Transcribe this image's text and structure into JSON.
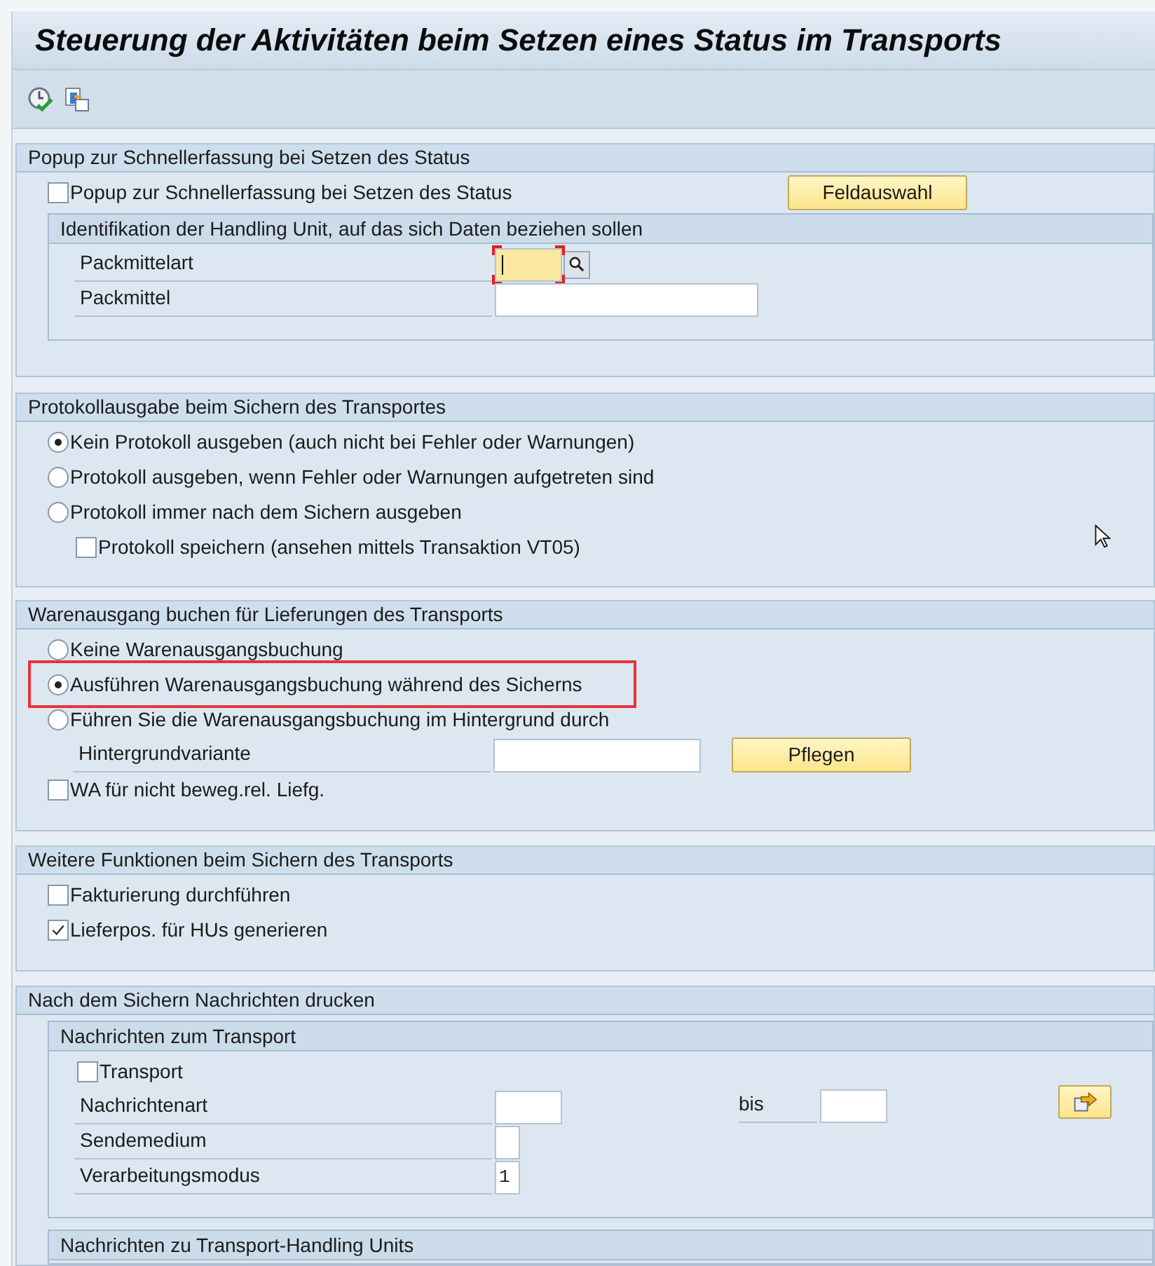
{
  "window": {
    "title": "Steuerung der Aktivitäten beim Setzen eines Status im Transports"
  },
  "toolbar": [
    {
      "kind": "execute"
    },
    {
      "kind": "copy"
    }
  ],
  "sections": [
    {
      "title": "Popup zur Schnellerfassung bei Setzen des Status",
      "items": [
        {
          "kind": "checkbox",
          "label": "Popup zur Schnellerfassung bei Setzen des Status",
          "checked": false,
          "button": "Feldauswahl"
        },
        {
          "kind": "group",
          "title": "Identifikation der Handling Unit, auf das sich Daten beziehen sollen",
          "items": [
            {
              "kind": "field",
              "label": "Packmittelart",
              "focused": true,
              "search_help": true
            },
            {
              "kind": "field",
              "label": "Packmittel",
              "focused": false
            }
          ]
        }
      ]
    },
    {
      "title": "Protokollausgabe beim Sichern des Transportes",
      "items": [
        {
          "kind": "radio",
          "label": "Kein Protokoll ausgeben (auch nicht bei Fehler oder Warnungen)",
          "selected": true
        },
        {
          "kind": "radio",
          "label": "Protokoll ausgeben, wenn Fehler oder Warnungen aufgetreten sind",
          "selected": false
        },
        {
          "kind": "radio",
          "label": "Protokoll immer nach dem Sichern ausgeben",
          "selected": false,
          "children": [
            {
              "kind": "checkbox",
              "label": "Protokoll speichern (ansehen mittels Transaktion VT05)",
              "checked": false
            }
          ]
        }
      ]
    },
    {
      "title": "Warenausgang buchen für Lieferungen des Transports",
      "items": [
        {
          "kind": "radio",
          "label": "Keine Warenausgangsbuchung",
          "selected": false,
          "highlighted": false
        },
        {
          "kind": "radio",
          "label": "Ausführen Warenausgangsbuchung während des Sicherns",
          "selected": true,
          "highlighted": true
        },
        {
          "kind": "radio",
          "label": "Führen Sie die Warenausgangsbuchung im Hintergrund durch",
          "selected": false,
          "highlighted": false
        },
        {
          "kind": "field",
          "label": "Hintergrundvariante",
          "focused": false,
          "button": "Pflegen"
        },
        {
          "kind": "checkbox",
          "label": "WA für nicht beweg.rel. Liefg.",
          "checked": false
        }
      ]
    },
    {
      "title": "Weitere Funktionen beim Sichern des Transports",
      "items": [
        {
          "kind": "checkbox",
          "label": "Fakturierung durchführen",
          "checked": false
        },
        {
          "kind": "checkbox",
          "label": "Lieferpos. für HUs generieren",
          "checked": true
        }
      ]
    },
    {
      "title": "Nach dem Sichern Nachrichten drucken",
      "items": [
        {
          "kind": "group",
          "title": "Nachrichten zum Transport",
          "items": [
            {
              "kind": "checkbox",
              "label": "Transport",
              "checked": false
            },
            {
              "kind": "field",
              "label": "Nachrichtenart",
              "focused": false,
              "range_label": "bis",
              "multiple_selection": true
            },
            {
              "kind": "field",
              "label": "Sendemedium",
              "focused": false
            },
            {
              "kind": "field",
              "label": "Verarbeitungsmodus",
              "focused": false,
              "value": "1"
            }
          ]
        },
        {
          "kind": "group",
          "title": "Nachrichten zu Transport-Handling Units"
        }
      ]
    }
  ]
}
